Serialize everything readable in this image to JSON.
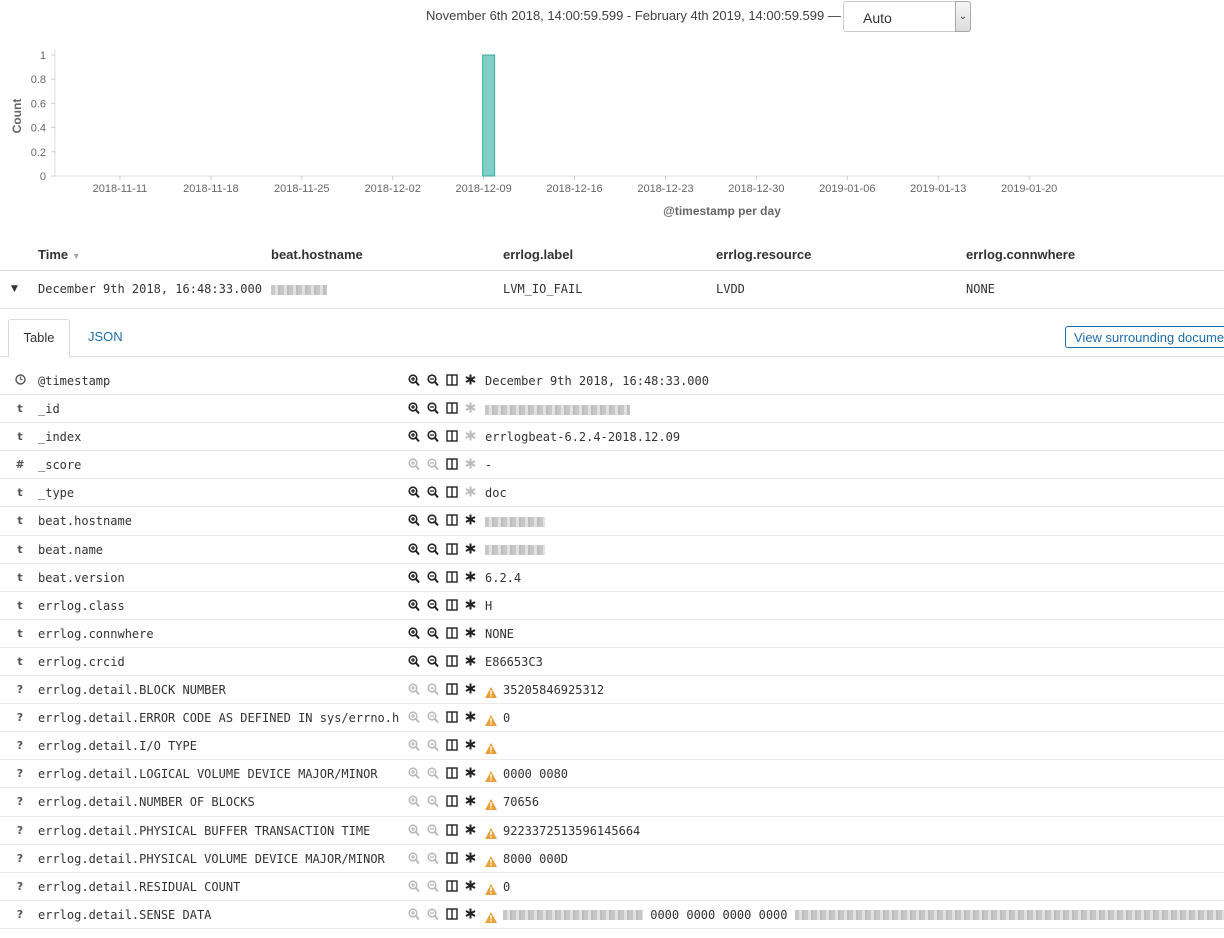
{
  "time_range": {
    "text": "November 6th 2018, 14:00:59.599 - February 4th 2019, 14:00:59.599 —",
    "interval": "Auto"
  },
  "chart_data": {
    "type": "bar",
    "x": [
      "2018-12-09"
    ],
    "values": [
      1
    ],
    "ylabel": "Count",
    "xlabel": "@timestamp per day",
    "ylim": [
      0,
      1
    ],
    "yticks": [
      "0",
      "0.2",
      "0.4",
      "0.6",
      "0.8",
      "1"
    ],
    "xticks": [
      "2018-11-11",
      "2018-11-18",
      "2018-11-25",
      "2018-12-02",
      "2018-12-09",
      "2018-12-16",
      "2018-12-23",
      "2018-12-30",
      "2019-01-06",
      "2019-01-13",
      "2019-01-20"
    ],
    "bar_color": "#7ecfc5"
  },
  "table": {
    "columns": [
      "Time",
      "beat.hostname",
      "errlog.label",
      "errlog.resource",
      "errlog.connwhere"
    ],
    "row": {
      "time": "December 9th 2018, 16:48:33.000",
      "label": "LVM_IO_FAIL",
      "resource": "LVDD",
      "connwhere": "NONE"
    }
  },
  "doc_tabs": {
    "table": "Table",
    "json": "JSON",
    "surrounding": "View surrounding documents"
  },
  "fields": [
    {
      "type": "clock",
      "name": "@timestamp",
      "value": "December 9th 2018, 16:48:33.000",
      "filterable": true,
      "exists": true
    },
    {
      "type": "t",
      "name": "_id",
      "value": "",
      "filterable": true,
      "exists": false,
      "blur": 145
    },
    {
      "type": "t",
      "name": "_index",
      "value": "errlogbeat-6.2.4-2018.12.09",
      "filterable": true,
      "exists": false
    },
    {
      "type": "#",
      "name": "_score",
      "value": " -",
      "filterable": false,
      "exists": false
    },
    {
      "type": "t",
      "name": "_type",
      "value": "doc",
      "filterable": true,
      "exists": false
    },
    {
      "type": "t",
      "name": "beat.hostname",
      "value": "",
      "filterable": true,
      "exists": true,
      "blur": 60
    },
    {
      "type": "t",
      "name": "beat.name",
      "value": "",
      "filterable": true,
      "exists": true,
      "blur": 60
    },
    {
      "type": "t",
      "name": "beat.version",
      "value": "6.2.4",
      "filterable": true,
      "exists": true
    },
    {
      "type": "t",
      "name": "errlog.class",
      "value": "H",
      "filterable": true,
      "exists": true
    },
    {
      "type": "t",
      "name": "errlog.connwhere",
      "value": "NONE",
      "filterable": true,
      "exists": true
    },
    {
      "type": "t",
      "name": "errlog.crcid",
      "value": "E86653C3",
      "filterable": true,
      "exists": true
    },
    {
      "type": "?",
      "name": "errlog.detail.BLOCK NUMBER",
      "value": "35205846925312",
      "filterable": false,
      "exists": true,
      "warn": true
    },
    {
      "type": "?",
      "name": "errlog.detail.ERROR CODE AS DEFINED IN sys/errno.h",
      "value": "0",
      "filterable": false,
      "exists": true,
      "warn": true
    },
    {
      "type": "?",
      "name": "errlog.detail.I/O TYPE",
      "value": "",
      "filterable": false,
      "exists": true,
      "warn": true
    },
    {
      "type": "?",
      "name": "errlog.detail.LOGICAL VOLUME DEVICE MAJOR/MINOR",
      "value": "0000 0080",
      "filterable": false,
      "exists": true,
      "warn": true
    },
    {
      "type": "?",
      "name": "errlog.detail.NUMBER OF BLOCKS",
      "value": "70656",
      "filterable": false,
      "exists": true,
      "warn": true
    },
    {
      "type": "?",
      "name": "errlog.detail.PHYSICAL BUFFER TRANSACTION TIME",
      "value": "9223372513596145664",
      "filterable": false,
      "exists": true,
      "warn": true
    },
    {
      "type": "?",
      "name": "errlog.detail.PHYSICAL VOLUME DEVICE MAJOR/MINOR",
      "value": "8000 000D",
      "filterable": false,
      "exists": true,
      "warn": true
    },
    {
      "type": "?",
      "name": "errlog.detail.RESIDUAL COUNT",
      "value": "0",
      "filterable": false,
      "exists": true,
      "warn": true
    },
    {
      "type": "?",
      "name": "errlog.detail.SENSE DATA",
      "value": "0000 0000 0000 0000",
      "filterable": false,
      "exists": true,
      "warn": true,
      "sense": true
    }
  ]
}
